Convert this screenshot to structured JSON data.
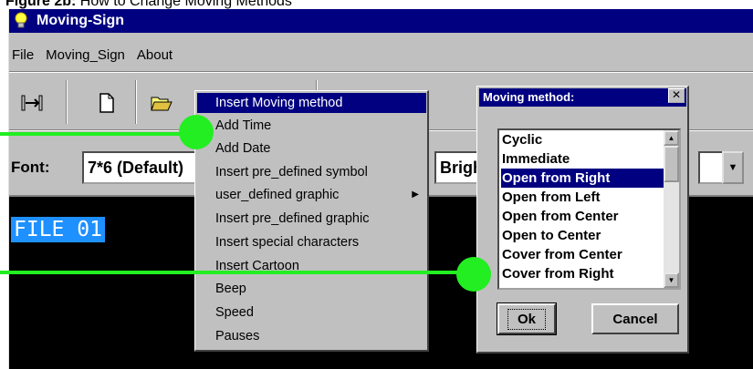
{
  "caption": {
    "label": "Figure 2b:",
    "text": " How to Change Moving Methods"
  },
  "window": {
    "title": "Moving-Sign"
  },
  "menu": [
    "File",
    "Moving_Sign",
    "About"
  ],
  "toolbar": {
    "icons": [
      "align-stretch-icon",
      "new-file-icon",
      "open-folder-icon"
    ]
  },
  "fontbar": {
    "label": "Font:",
    "font_value": "7*6 (Default)",
    "second_value": "Brightness"
  },
  "editor": {
    "text": "FILE 01"
  },
  "context_menu": {
    "items": [
      {
        "label": "Insert Moving method",
        "selected": true
      },
      {
        "label": "Add Time"
      },
      {
        "label": "Add Date"
      },
      {
        "label": "Insert pre_defined symbol"
      },
      {
        "label": "user_defined graphic",
        "submenu": true
      },
      {
        "label": "Insert pre_defined graphic"
      },
      {
        "label": "Insert special characters"
      },
      {
        "label": "Insert Cartoon"
      },
      {
        "label": "Beep"
      },
      {
        "label": "Speed"
      },
      {
        "label": "Pauses"
      }
    ]
  },
  "dialog": {
    "title": "Moving method:",
    "options": [
      "Cyclic",
      "Immediate",
      "Open from Right",
      "Open from Left",
      "Open from Center",
      "Open to Center",
      "Cover from Center",
      "Cover from Right"
    ],
    "selected": "Open from Right",
    "ok_label": "Ok",
    "cancel_label": "Cancel"
  },
  "colors": {
    "callout": "#22ee22",
    "titlebar": "#000080",
    "highlight": "#1e90ff"
  }
}
